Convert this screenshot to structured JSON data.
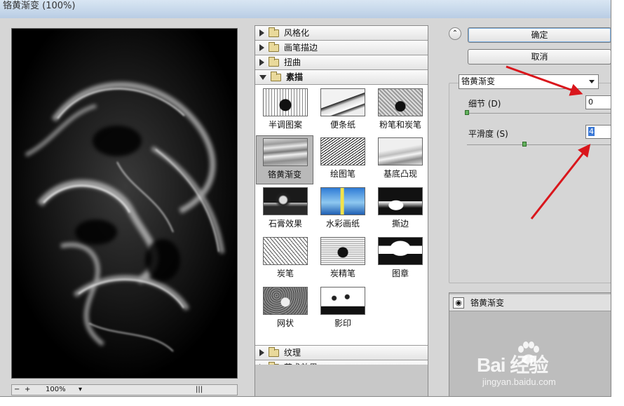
{
  "window": {
    "title": "铬黄渐变 (100%)"
  },
  "preview": {
    "zoom": "100%"
  },
  "filter_gallery": {
    "categories_top": [
      {
        "label": "风格化",
        "open": false
      },
      {
        "label": "画笔描边",
        "open": false
      },
      {
        "label": "扭曲",
        "open": false
      },
      {
        "label": "素描",
        "open": true
      }
    ],
    "thumbnails": [
      {
        "label": "半调图案"
      },
      {
        "label": "便条纸"
      },
      {
        "label": "粉笔和炭笔"
      },
      {
        "label": "铬黄渐变",
        "selected": true
      },
      {
        "label": "绘图笔"
      },
      {
        "label": "基底凸现"
      },
      {
        "label": "石膏效果"
      },
      {
        "label": "水彩画纸"
      },
      {
        "label": "撕边"
      },
      {
        "label": "炭笔"
      },
      {
        "label": "炭精笔"
      },
      {
        "label": "图章"
      },
      {
        "label": "网状"
      },
      {
        "label": "影印"
      }
    ],
    "categories_bottom": [
      {
        "label": "纹理",
        "open": false
      },
      {
        "label": "艺术效果",
        "open": false
      }
    ]
  },
  "settings": {
    "ok_label": "确定",
    "cancel_label": "取消",
    "filter_select": "铬黄渐变",
    "detail": {
      "label": "细节 (D)",
      "value": "0",
      "level": 0.0
    },
    "smoothness": {
      "label": "平滑度 (S)",
      "value": "4",
      "level": 0.4
    }
  },
  "layers": {
    "effect_layer": "铬黄渐变"
  },
  "watermark": {
    "brand": "Bai  经验",
    "site": "jingyan.baidu.com"
  },
  "colors": {
    "arrow": "#d9161c",
    "accent": "#3a78d6",
    "slider_knob": "#63b25e"
  }
}
